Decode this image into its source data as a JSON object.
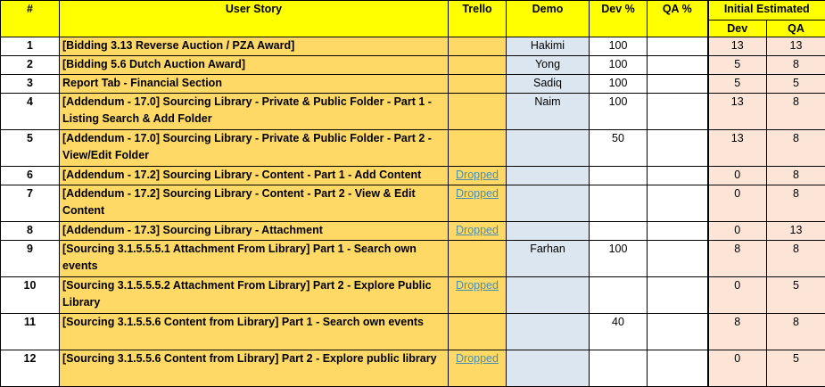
{
  "headers": {
    "num": "#",
    "story": "User Story",
    "trello": "Trello",
    "demo": "Demo",
    "dev_pct": "Dev %",
    "qa_pct": "QA %",
    "initial_estimated": "Initial Estimated",
    "est_dev": "Dev",
    "est_qa": "QA"
  },
  "rows": [
    {
      "num": "1",
      "story": "[Bidding 3.13 Reverse Auction / PZA Award]",
      "trello": "",
      "demo": "Hakimi",
      "dev": "100",
      "qa": "",
      "est_dev": "13",
      "est_qa": "13"
    },
    {
      "num": "2",
      "story": "[Bidding 5.6 Dutch Auction Award]",
      "trello": "",
      "demo": "Yong",
      "dev": "100",
      "qa": "",
      "est_dev": "5",
      "est_qa": "8"
    },
    {
      "num": "3",
      "story": "Report Tab - Financial Section",
      "trello": "",
      "demo": "Sadiq",
      "dev": "100",
      "qa": "",
      "est_dev": "5",
      "est_qa": "5"
    },
    {
      "num": "4",
      "story": "[Addendum - 17.0] Sourcing Library - Private & Public Folder - Part 1 - Listing Search & Add Folder",
      "trello": "",
      "demo": "Naim",
      "dev": "100",
      "qa": "",
      "est_dev": "13",
      "est_qa": "8"
    },
    {
      "num": "5",
      "story": "[Addendum - 17.0] Sourcing Library - Private & Public Folder - Part 2 - View/Edit Folder",
      "trello": "",
      "demo": "",
      "dev": "50",
      "qa": "",
      "est_dev": "13",
      "est_qa": "8"
    },
    {
      "num": "6",
      "story": "[Addendum - 17.2] Sourcing Library - Content - Part 1 - Add Content",
      "trello": "Dropped",
      "demo": "",
      "dev": "",
      "qa": "",
      "est_dev": "0",
      "est_qa": "8"
    },
    {
      "num": "7",
      "story": "[Addendum - 17.2] Sourcing Library - Content - Part 2 - View & Edit Content",
      "trello": "Dropped",
      "demo": "",
      "dev": "",
      "qa": "",
      "est_dev": "0",
      "est_qa": "8"
    },
    {
      "num": "8",
      "story": "[Addendum - 17.3] Sourcing Library - Attachment",
      "trello": "Dropped",
      "demo": "",
      "dev": "",
      "qa": "",
      "est_dev": "0",
      "est_qa": "13"
    },
    {
      "num": "9",
      "story": "[Sourcing 3.1.5.5.5.1 Attachment From Library] Part 1 - Search own events",
      "trello": "",
      "demo": "Farhan",
      "dev": "100",
      "qa": "",
      "est_dev": "8",
      "est_qa": "8"
    },
    {
      "num": "10",
      "story": "[Sourcing 3.1.5.5.5.2 Attachment From Library] Part 2 - Explore Public Library",
      "trello": "Dropped",
      "demo": "",
      "dev": "",
      "qa": "",
      "est_dev": "0",
      "est_qa": "5"
    },
    {
      "num": "11",
      "story": "[Sourcing 3.1.5.5.6 Content from Library] Part 1 - Search own events",
      "trello": "",
      "demo": "",
      "dev": "40",
      "qa": "",
      "est_dev": "8",
      "est_qa": "8"
    },
    {
      "num": "12",
      "story": " [Sourcing 3.1.5.5.6 Content from Library] Part 2 - Explore public library",
      "trello": "Dropped",
      "demo": "",
      "dev": "",
      "qa": "",
      "est_dev": "0",
      "est_qa": "5"
    }
  ]
}
